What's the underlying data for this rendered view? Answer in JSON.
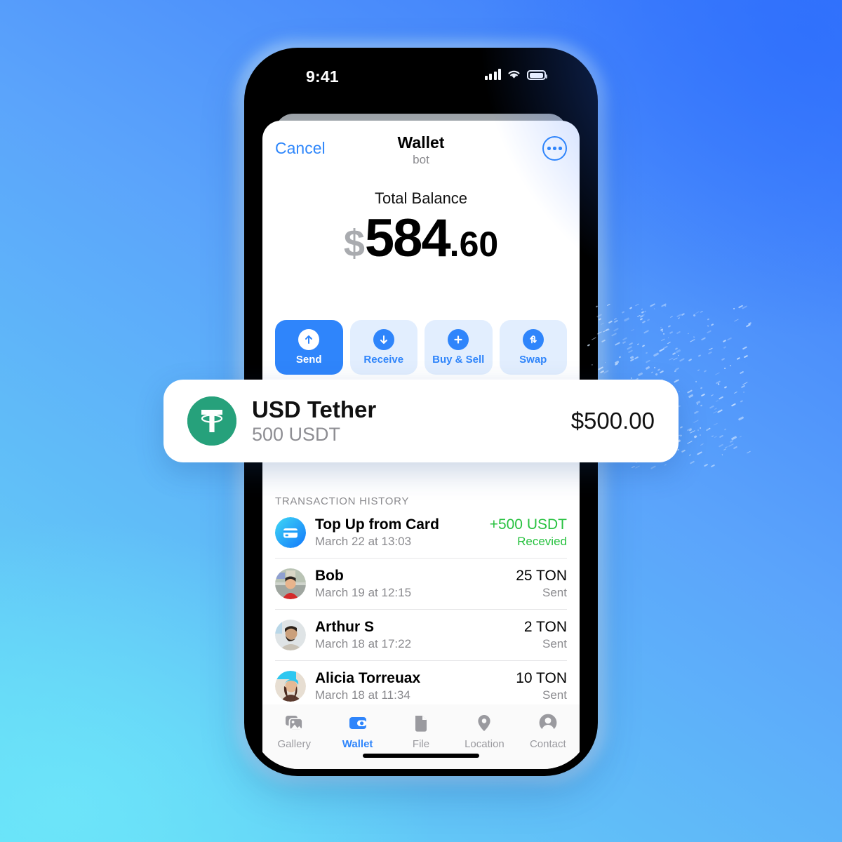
{
  "status_bar": {
    "time": "9:41",
    "signal_icon": "cellular-bars-icon",
    "wifi_icon": "wifi-icon",
    "battery_icon": "battery-icon"
  },
  "nav": {
    "cancel_label": "Cancel",
    "title": "Wallet",
    "subtitle": "bot",
    "more_icon": "more-ellipsis-icon"
  },
  "balance": {
    "label": "Total Balance",
    "currency": "$",
    "integer": "584",
    "decimal": ".60",
    "full": "$584.60"
  },
  "actions": [
    {
      "label": "Send",
      "icon": "arrow-up-icon",
      "active": true
    },
    {
      "label": "Receive",
      "icon": "arrow-down-icon",
      "active": false
    },
    {
      "label": "Buy & Sell",
      "icon": "plus-icon",
      "active": false
    },
    {
      "label": "Swap",
      "icon": "swap-arrows-icon",
      "active": false
    }
  ],
  "asset_card": {
    "logo_icon": "tether-logo-icon",
    "name": "USD Tether",
    "subtitle": "500 USDT",
    "amount": "$500.00",
    "brand_color": "#26a17b"
  },
  "transactions": {
    "section_title": "TRANSACTION HISTORY",
    "items": [
      {
        "avatar": "credit-card-icon",
        "name": "Top Up from Card",
        "date": "March 22 at 13:03",
        "amount": "+500 USDT",
        "status": "Recevied",
        "credit": true
      },
      {
        "avatar": "avatar-photo",
        "name": "Bob",
        "date": "March 19 at 12:15",
        "amount": "25 TON",
        "status": "Sent",
        "credit": false
      },
      {
        "avatar": "avatar-photo",
        "name": "Arthur S",
        "date": "March 18 at 17:22",
        "amount": "2 TON",
        "status": "Sent",
        "credit": false
      },
      {
        "avatar": "avatar-photo",
        "name": "Alicia Torreuax",
        "date": "March 18 at 11:34",
        "amount": "10 TON",
        "status": "Sent",
        "credit": false
      }
    ]
  },
  "tabbar": {
    "items": [
      {
        "label": "Gallery",
        "icon": "gallery-icon",
        "active": false
      },
      {
        "label": "Wallet",
        "icon": "wallet-icon",
        "active": true
      },
      {
        "label": "File",
        "icon": "file-icon",
        "active": false
      },
      {
        "label": "Location",
        "icon": "location-pin-icon",
        "active": false
      },
      {
        "label": "Contact",
        "icon": "contact-person-icon",
        "active": false
      }
    ]
  },
  "colors": {
    "accent": "#2f85fb",
    "accent_soft": "#e2eefe",
    "credit_green": "#27c13f",
    "muted": "#8a8a8e",
    "bg_top_right": "#3776fb",
    "bg_bottom_left": "#62dff6"
  }
}
